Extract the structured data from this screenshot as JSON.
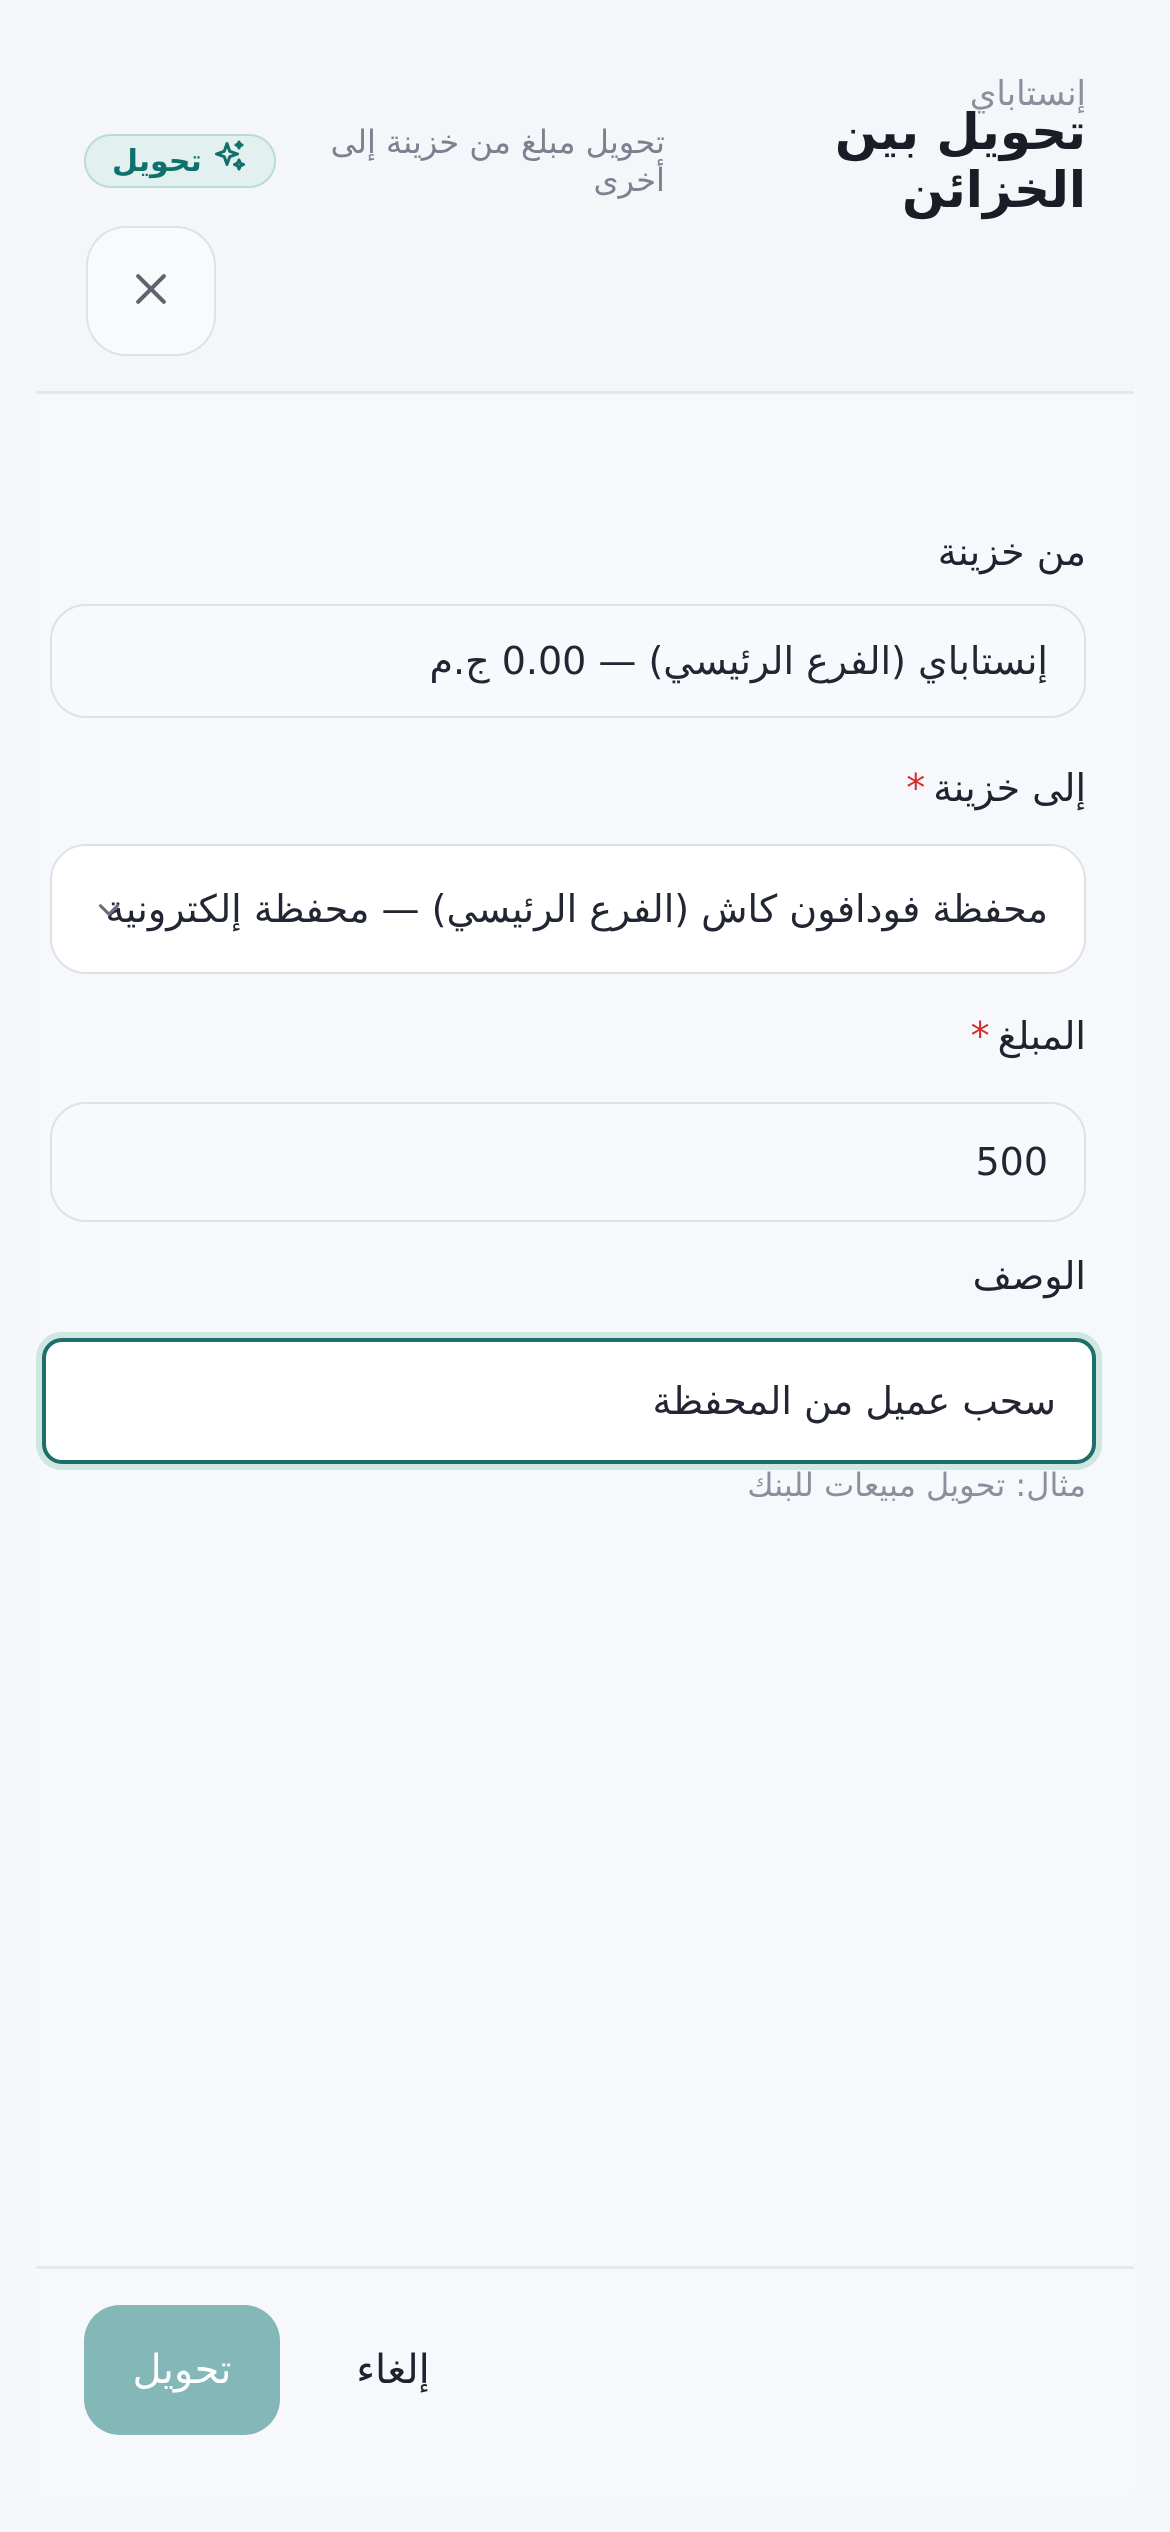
{
  "header": {
    "breadcrumb": "إنستاباي",
    "title": "تحويل بين الخزائن",
    "subtitle": "تحويل مبلغ من خزينة إلى أخرى",
    "badge_label": "تحويل",
    "badge_icon": "sparkles-icon",
    "close_icon": "close-icon"
  },
  "form": {
    "from": {
      "label": "من خزينة",
      "value": "إنستاباي (الفرع الرئيسي) — 0.00 ج.م"
    },
    "to": {
      "label": "إلى خزينة",
      "required": "*",
      "value": "محفظة فودافون كاش (الفرع الرئيسي) — محفظة إلكترونية"
    },
    "amount": {
      "label": "المبلغ",
      "required": "*",
      "value": "500"
    },
    "description": {
      "label": "الوصف",
      "value": "سحب عميل من المحفظة",
      "hint": "مثال: تحويل مبيعات للبنك"
    }
  },
  "footer": {
    "submit_label": "تحويل",
    "cancel_label": "إلغاء"
  },
  "colors": {
    "accent": "#1b6f6c",
    "submit_bg": "#83b7b8",
    "required": "#d32f2f"
  }
}
